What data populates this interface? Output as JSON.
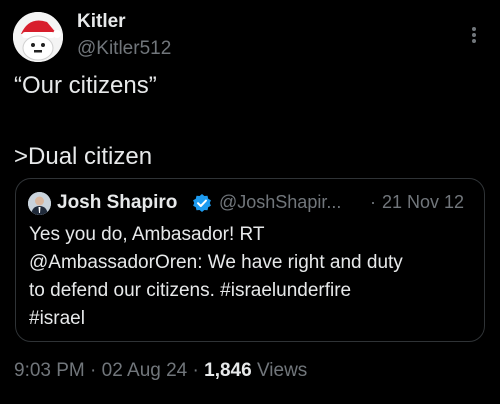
{
  "author": {
    "display_name": "Kitler",
    "handle": "@Kitler512"
  },
  "tweet": {
    "line1": "“Our citizens”",
    "line2": ">Dual citizen"
  },
  "quoted": {
    "display_name": "Josh Shapiro",
    "handle": "@JoshShapir...",
    "separator": "·",
    "date": "21 Nov 12",
    "lines": [
      "Yes you do, Ambasador! RT",
      "@AmbassadorOren: We have right and duty",
      "to defend our citizens. #israelunderfire",
      "#israel"
    ]
  },
  "meta": {
    "time": "9:03 PM",
    "sep1": " · ",
    "date": "02 Aug 24",
    "sep2": " · ",
    "views_count": "1,846",
    "views_label": " Views"
  },
  "icons": {
    "more": "more-vertical-icon",
    "verified": "verified-badge-icon"
  },
  "colors": {
    "background": "#000000",
    "primary_text": "#e7e9ea",
    "secondary_text": "#71767b",
    "border": "#2f3336",
    "verified_blue": "#1d9bf0"
  }
}
